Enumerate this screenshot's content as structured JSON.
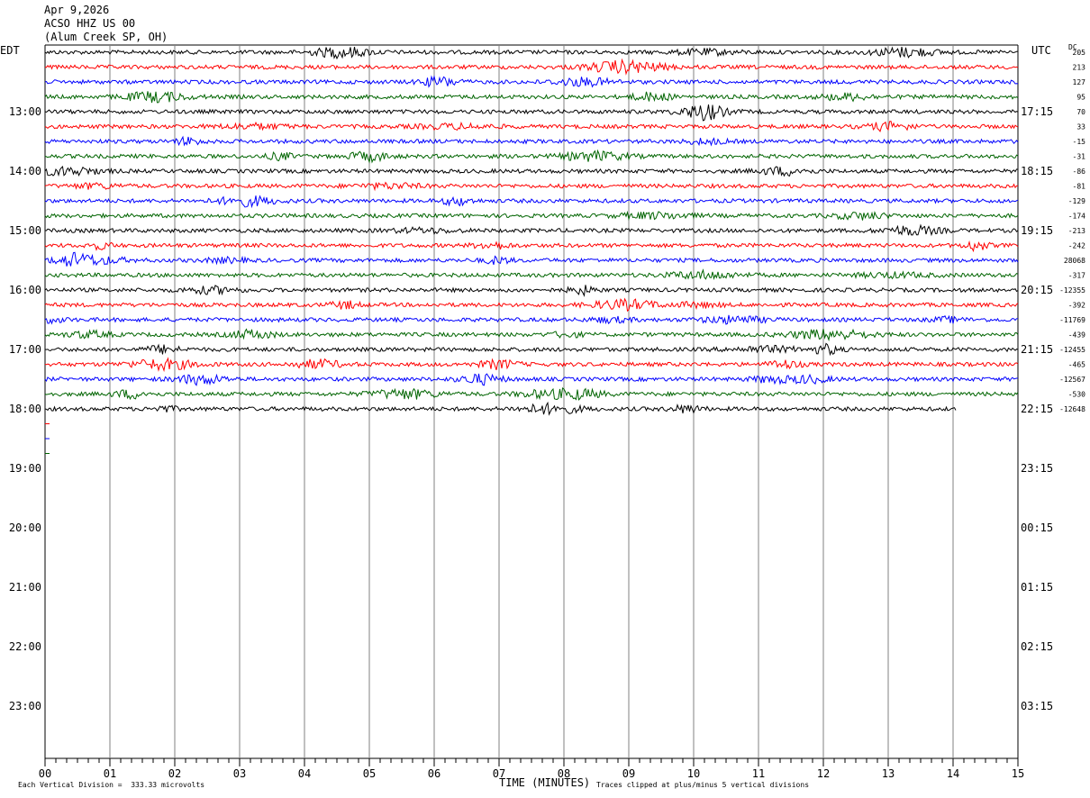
{
  "header": {
    "date": "Apr 9,2026",
    "station": "ACSO HHZ US 00",
    "location": "(Alum Creek SP, OH)"
  },
  "chart_data": {
    "type": "line",
    "title": "Apr 9,2026  ACSO HHZ US 00  (Alum Creek SP, OH)",
    "xlabel": "TIME (MINUTES)",
    "left_axis_label": "EDT",
    "right_axis_label": "UTC",
    "dc_label": "DC",
    "xlim": [
      0,
      15
    ],
    "x_ticks": [
      "00",
      "01",
      "02",
      "03",
      "04",
      "05",
      "06",
      "07",
      "08",
      "09",
      "10",
      "11",
      "12",
      "13",
      "14",
      "15"
    ],
    "left_hour_labels": [
      "13:00",
      "14:00",
      "15:00",
      "16:00",
      "17:00",
      "18:00",
      "19:00",
      "20:00",
      "21:00",
      "22:00",
      "23:00"
    ],
    "right_hour_labels": [
      "17:15",
      "18:15",
      "19:15",
      "20:15",
      "21:15",
      "22:15",
      "23:15",
      "00:15",
      "01:15",
      "02:15",
      "03:15"
    ],
    "minutes_per_line": 15,
    "lines_per_hour": 4,
    "trace_colors": [
      "#000000",
      "#ff0000",
      "#0000ff",
      "#006400"
    ],
    "dc_offsets": [
      "205",
      "213",
      "127",
      "95",
      "70",
      "33",
      "-15",
      "-31",
      "-86",
      "-81",
      "-129",
      "-174",
      "-213",
      "-242",
      "28068",
      "-317",
      "-12355",
      "-392",
      "-11769",
      "-439",
      "-12455",
      "-465",
      "-12567",
      "-530",
      "-12648"
    ],
    "last_trace_end_minute": 14.05,
    "scale_note": "Each Vertical Division =  333.33 microvolts",
    "clip_note": "Traces clipped at plus/minus 5 vertical divisions",
    "grid": true
  }
}
